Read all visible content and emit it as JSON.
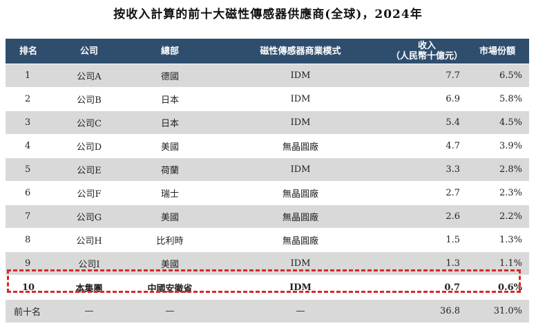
{
  "title": "按收入計算的前十大磁性傳感器供應商(全球)，2024年",
  "headers": {
    "rank": "排名",
    "company": "公司",
    "hq": "總部",
    "model": "磁性傳感器商業模式",
    "revenue_line1": "收入",
    "revenue_line2": "（人民幣十億元）",
    "share": "市場份額"
  },
  "rows": [
    {
      "rank": "1",
      "company": "公司A",
      "hq": "德國",
      "model": "IDM",
      "revenue": "7.7",
      "share": "6.5%"
    },
    {
      "rank": "2",
      "company": "公司B",
      "hq": "日本",
      "model": "IDM",
      "revenue": "6.9",
      "share": "5.8%"
    },
    {
      "rank": "3",
      "company": "公司C",
      "hq": "日本",
      "model": "IDM",
      "revenue": "5.4",
      "share": "4.5%"
    },
    {
      "rank": "4",
      "company": "公司D",
      "hq": "美國",
      "model": "無晶圓廠",
      "revenue": "4.7",
      "share": "3.9%"
    },
    {
      "rank": "5",
      "company": "公司E",
      "hq": "荷蘭",
      "model": "IDM",
      "revenue": "3.3",
      "share": "2.8%"
    },
    {
      "rank": "6",
      "company": "公司F",
      "hq": "瑞士",
      "model": "無晶圓廠",
      "revenue": "2.7",
      "share": "2.3%"
    },
    {
      "rank": "7",
      "company": "公司G",
      "hq": "美國",
      "model": "無晶圓廠",
      "revenue": "2.6",
      "share": "2.2%"
    },
    {
      "rank": "8",
      "company": "公司H",
      "hq": "比利時",
      "model": "無晶圓廠",
      "revenue": "1.5",
      "share": "1.3%"
    },
    {
      "rank": "9",
      "company": "公司I",
      "hq": "美國",
      "model": "IDM",
      "revenue": "1.3",
      "share": "1.1%"
    },
    {
      "rank": "10",
      "company": "本集團",
      "hq": "中國安徽省",
      "model": "IDM",
      "revenue": "0.7",
      "share": "0.6%"
    }
  ],
  "footer": {
    "rank": "前十名",
    "company": "—",
    "hq": "—",
    "model": "—",
    "revenue": "36.8",
    "share": "31.0%"
  },
  "colors": {
    "header_bg": "#2f4e6e",
    "stripe": "#d9d9d9",
    "highlight_border": "#d7262c"
  }
}
